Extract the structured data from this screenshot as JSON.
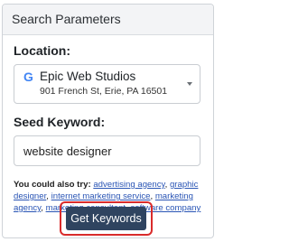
{
  "panel": {
    "title": "Search Parameters"
  },
  "location": {
    "label": "Location:",
    "icon": "google-g-icon",
    "name": "Epic Web Studios",
    "address": "901 French St, Erie, PA 16501"
  },
  "seed": {
    "label": "Seed Keyword:",
    "value": "website designer"
  },
  "suggestions": {
    "lead": "You could also try:",
    "items": [
      "advertising agency",
      "graphic designer",
      "internet marketing service",
      "marketing agency",
      "marketing consultant",
      "software company"
    ]
  },
  "actions": {
    "submit_label": "Get Keywords"
  },
  "colors": {
    "button_bg": "#2f4460",
    "highlight": "#d92b2b",
    "link": "#2a55b5",
    "google_blue": "#4285f4"
  }
}
